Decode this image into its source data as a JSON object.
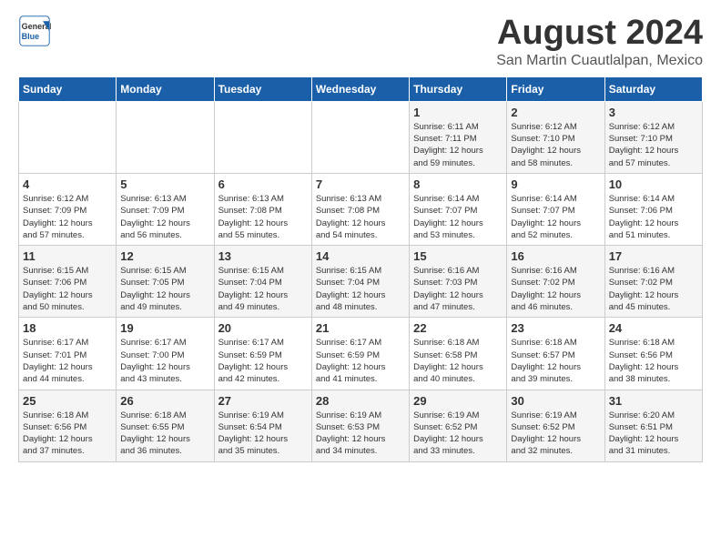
{
  "logo": {
    "line1": "General",
    "line2": "Blue"
  },
  "title": "August 2024",
  "subtitle": "San Martin Cuautlalpan, Mexico",
  "days_of_week": [
    "Sunday",
    "Monday",
    "Tuesday",
    "Wednesday",
    "Thursday",
    "Friday",
    "Saturday"
  ],
  "weeks": [
    [
      {
        "day": "",
        "info": ""
      },
      {
        "day": "",
        "info": ""
      },
      {
        "day": "",
        "info": ""
      },
      {
        "day": "",
        "info": ""
      },
      {
        "day": "1",
        "info": "Sunrise: 6:11 AM\nSunset: 7:11 PM\nDaylight: 12 hours\nand 59 minutes."
      },
      {
        "day": "2",
        "info": "Sunrise: 6:12 AM\nSunset: 7:10 PM\nDaylight: 12 hours\nand 58 minutes."
      },
      {
        "day": "3",
        "info": "Sunrise: 6:12 AM\nSunset: 7:10 PM\nDaylight: 12 hours\nand 57 minutes."
      }
    ],
    [
      {
        "day": "4",
        "info": "Sunrise: 6:12 AM\nSunset: 7:09 PM\nDaylight: 12 hours\nand 57 minutes."
      },
      {
        "day": "5",
        "info": "Sunrise: 6:13 AM\nSunset: 7:09 PM\nDaylight: 12 hours\nand 56 minutes."
      },
      {
        "day": "6",
        "info": "Sunrise: 6:13 AM\nSunset: 7:08 PM\nDaylight: 12 hours\nand 55 minutes."
      },
      {
        "day": "7",
        "info": "Sunrise: 6:13 AM\nSunset: 7:08 PM\nDaylight: 12 hours\nand 54 minutes."
      },
      {
        "day": "8",
        "info": "Sunrise: 6:14 AM\nSunset: 7:07 PM\nDaylight: 12 hours\nand 53 minutes."
      },
      {
        "day": "9",
        "info": "Sunrise: 6:14 AM\nSunset: 7:07 PM\nDaylight: 12 hours\nand 52 minutes."
      },
      {
        "day": "10",
        "info": "Sunrise: 6:14 AM\nSunset: 7:06 PM\nDaylight: 12 hours\nand 51 minutes."
      }
    ],
    [
      {
        "day": "11",
        "info": "Sunrise: 6:15 AM\nSunset: 7:06 PM\nDaylight: 12 hours\nand 50 minutes."
      },
      {
        "day": "12",
        "info": "Sunrise: 6:15 AM\nSunset: 7:05 PM\nDaylight: 12 hours\nand 49 minutes."
      },
      {
        "day": "13",
        "info": "Sunrise: 6:15 AM\nSunset: 7:04 PM\nDaylight: 12 hours\nand 49 minutes."
      },
      {
        "day": "14",
        "info": "Sunrise: 6:15 AM\nSunset: 7:04 PM\nDaylight: 12 hours\nand 48 minutes."
      },
      {
        "day": "15",
        "info": "Sunrise: 6:16 AM\nSunset: 7:03 PM\nDaylight: 12 hours\nand 47 minutes."
      },
      {
        "day": "16",
        "info": "Sunrise: 6:16 AM\nSunset: 7:02 PM\nDaylight: 12 hours\nand 46 minutes."
      },
      {
        "day": "17",
        "info": "Sunrise: 6:16 AM\nSunset: 7:02 PM\nDaylight: 12 hours\nand 45 minutes."
      }
    ],
    [
      {
        "day": "18",
        "info": "Sunrise: 6:17 AM\nSunset: 7:01 PM\nDaylight: 12 hours\nand 44 minutes."
      },
      {
        "day": "19",
        "info": "Sunrise: 6:17 AM\nSunset: 7:00 PM\nDaylight: 12 hours\nand 43 minutes."
      },
      {
        "day": "20",
        "info": "Sunrise: 6:17 AM\nSunset: 6:59 PM\nDaylight: 12 hours\nand 42 minutes."
      },
      {
        "day": "21",
        "info": "Sunrise: 6:17 AM\nSunset: 6:59 PM\nDaylight: 12 hours\nand 41 minutes."
      },
      {
        "day": "22",
        "info": "Sunrise: 6:18 AM\nSunset: 6:58 PM\nDaylight: 12 hours\nand 40 minutes."
      },
      {
        "day": "23",
        "info": "Sunrise: 6:18 AM\nSunset: 6:57 PM\nDaylight: 12 hours\nand 39 minutes."
      },
      {
        "day": "24",
        "info": "Sunrise: 6:18 AM\nSunset: 6:56 PM\nDaylight: 12 hours\nand 38 minutes."
      }
    ],
    [
      {
        "day": "25",
        "info": "Sunrise: 6:18 AM\nSunset: 6:56 PM\nDaylight: 12 hours\nand 37 minutes."
      },
      {
        "day": "26",
        "info": "Sunrise: 6:18 AM\nSunset: 6:55 PM\nDaylight: 12 hours\nand 36 minutes."
      },
      {
        "day": "27",
        "info": "Sunrise: 6:19 AM\nSunset: 6:54 PM\nDaylight: 12 hours\nand 35 minutes."
      },
      {
        "day": "28",
        "info": "Sunrise: 6:19 AM\nSunset: 6:53 PM\nDaylight: 12 hours\nand 34 minutes."
      },
      {
        "day": "29",
        "info": "Sunrise: 6:19 AM\nSunset: 6:52 PM\nDaylight: 12 hours\nand 33 minutes."
      },
      {
        "day": "30",
        "info": "Sunrise: 6:19 AM\nSunset: 6:52 PM\nDaylight: 12 hours\nand 32 minutes."
      },
      {
        "day": "31",
        "info": "Sunrise: 6:20 AM\nSunset: 6:51 PM\nDaylight: 12 hours\nand 31 minutes."
      }
    ]
  ]
}
